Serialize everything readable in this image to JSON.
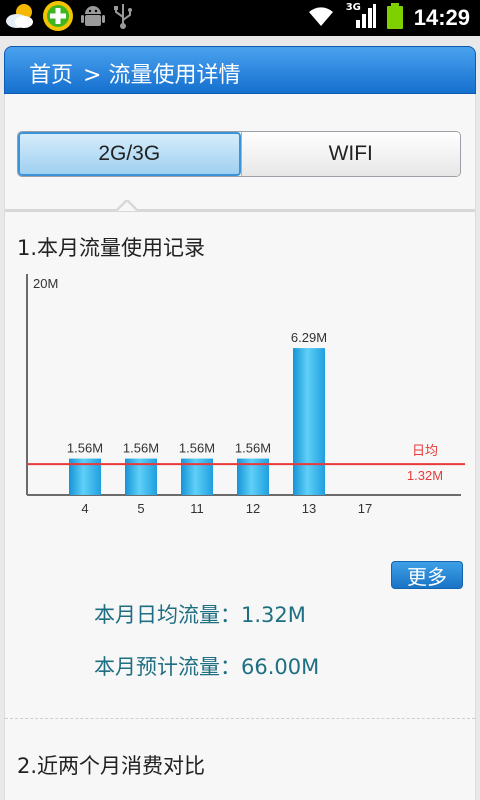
{
  "status_bar": {
    "time": "14:29",
    "network_label": "3G",
    "icons": [
      "weather-icon",
      "add-app-icon",
      "android-debug-icon",
      "usb-icon",
      "wifi-icon",
      "signal-icon",
      "battery-icon"
    ]
  },
  "header": {
    "breadcrumb": [
      "首页",
      "> 流量使用详情"
    ]
  },
  "tabs": [
    {
      "label": "2G/3G",
      "active": true
    },
    {
      "label": "WIFI",
      "active": false
    }
  ],
  "section1": {
    "title": "1.本月流量使用记录"
  },
  "chart_data": {
    "type": "bar",
    "y_max_label": "20M",
    "categories": [
      "4",
      "5",
      "11",
      "12",
      "13",
      "17"
    ],
    "values": [
      1.56,
      1.56,
      1.56,
      1.56,
      6.29,
      null
    ],
    "value_labels": [
      "1.56M",
      "1.56M",
      "1.56M",
      "1.56M",
      "6.29M",
      ""
    ],
    "average": {
      "label": "日均",
      "value": 1.32,
      "value_label": "1.32M",
      "color": "#e83a3a"
    },
    "bar_color": "#2aa9e4"
  },
  "more_button": {
    "label": "更多"
  },
  "stats": {
    "daily_avg": "本月日均流量：1.32M",
    "forecast": "本月预计流量：66.00M"
  },
  "section2": {
    "title": "2.近两个月消费对比"
  }
}
